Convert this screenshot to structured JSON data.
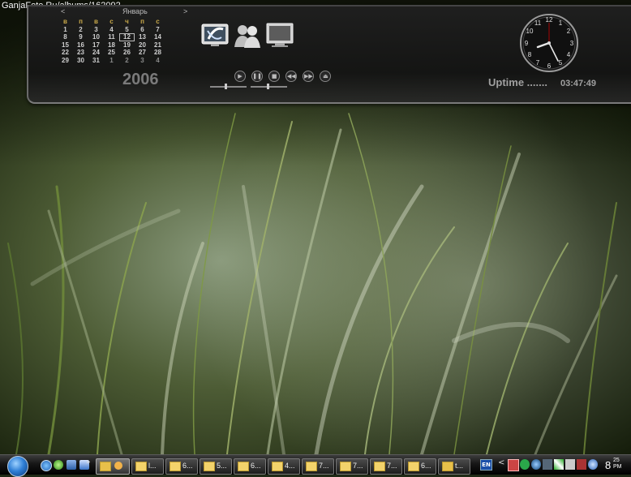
{
  "watermark": {
    "text": "GanjaFoto.Ru/albums/162092"
  },
  "calendar": {
    "prev": "<",
    "next": ">",
    "month": "Январь",
    "year": "2006",
    "weekdays": [
      "в",
      "п",
      "в",
      "с",
      "ч",
      "п",
      "с"
    ],
    "weeks": [
      [
        "1",
        "2",
        "3",
        "4",
        "5",
        "6",
        "7"
      ],
      [
        "8",
        "9",
        "10",
        "11",
        "12",
        "13",
        "14"
      ],
      [
        "15",
        "16",
        "17",
        "18",
        "19",
        "20",
        "21"
      ],
      [
        "22",
        "23",
        "24",
        "25",
        "26",
        "27",
        "28"
      ],
      [
        "29",
        "30",
        "31",
        "1",
        "2",
        "3",
        "4"
      ]
    ],
    "today": "12",
    "accent_color": "#c9a94a"
  },
  "dock": {
    "icons": [
      "skype-icon",
      "messenger-icon",
      "monitor-icon"
    ],
    "media_buttons": [
      {
        "name": "play-button",
        "glyph": "▶"
      },
      {
        "name": "pause-button",
        "glyph": "❚❚"
      },
      {
        "name": "stop-button",
        "glyph": "■"
      },
      {
        "name": "previous-button",
        "glyph": "◀◀"
      },
      {
        "name": "next-button",
        "glyph": "▶▶"
      },
      {
        "name": "eject-button",
        "glyph": "⏏"
      }
    ]
  },
  "uptime": {
    "label": "Uptime .......",
    "value": "03:47:49"
  },
  "taskbar": {
    "start": "start-orb-icon",
    "quick_launch": [
      "ie-icon",
      "refresh-icon",
      "show-desktop-icon",
      "outlook-icon"
    ],
    "overflow": "»",
    "tasks": [
      {
        "label": "",
        "active": true
      },
      {
        "label": "l..."
      },
      {
        "label": "6..."
      },
      {
        "label": "5..."
      },
      {
        "label": "6..."
      },
      {
        "label": "4..."
      },
      {
        "label": "7..."
      },
      {
        "label": "7..."
      },
      {
        "label": "7..."
      },
      {
        "label": "6..."
      },
      {
        "label": "t..."
      }
    ],
    "tray": {
      "language": "EN",
      "chevron": "<",
      "icons": [
        "printer-icon",
        "network-icon",
        "messenger-tray-icon",
        "antivirus-icon",
        "chart-icon",
        "display-icon",
        "skype-tray-icon"
      ]
    },
    "clock": {
      "hour": "8",
      "minutes": "25",
      "ampm": "PM"
    }
  }
}
